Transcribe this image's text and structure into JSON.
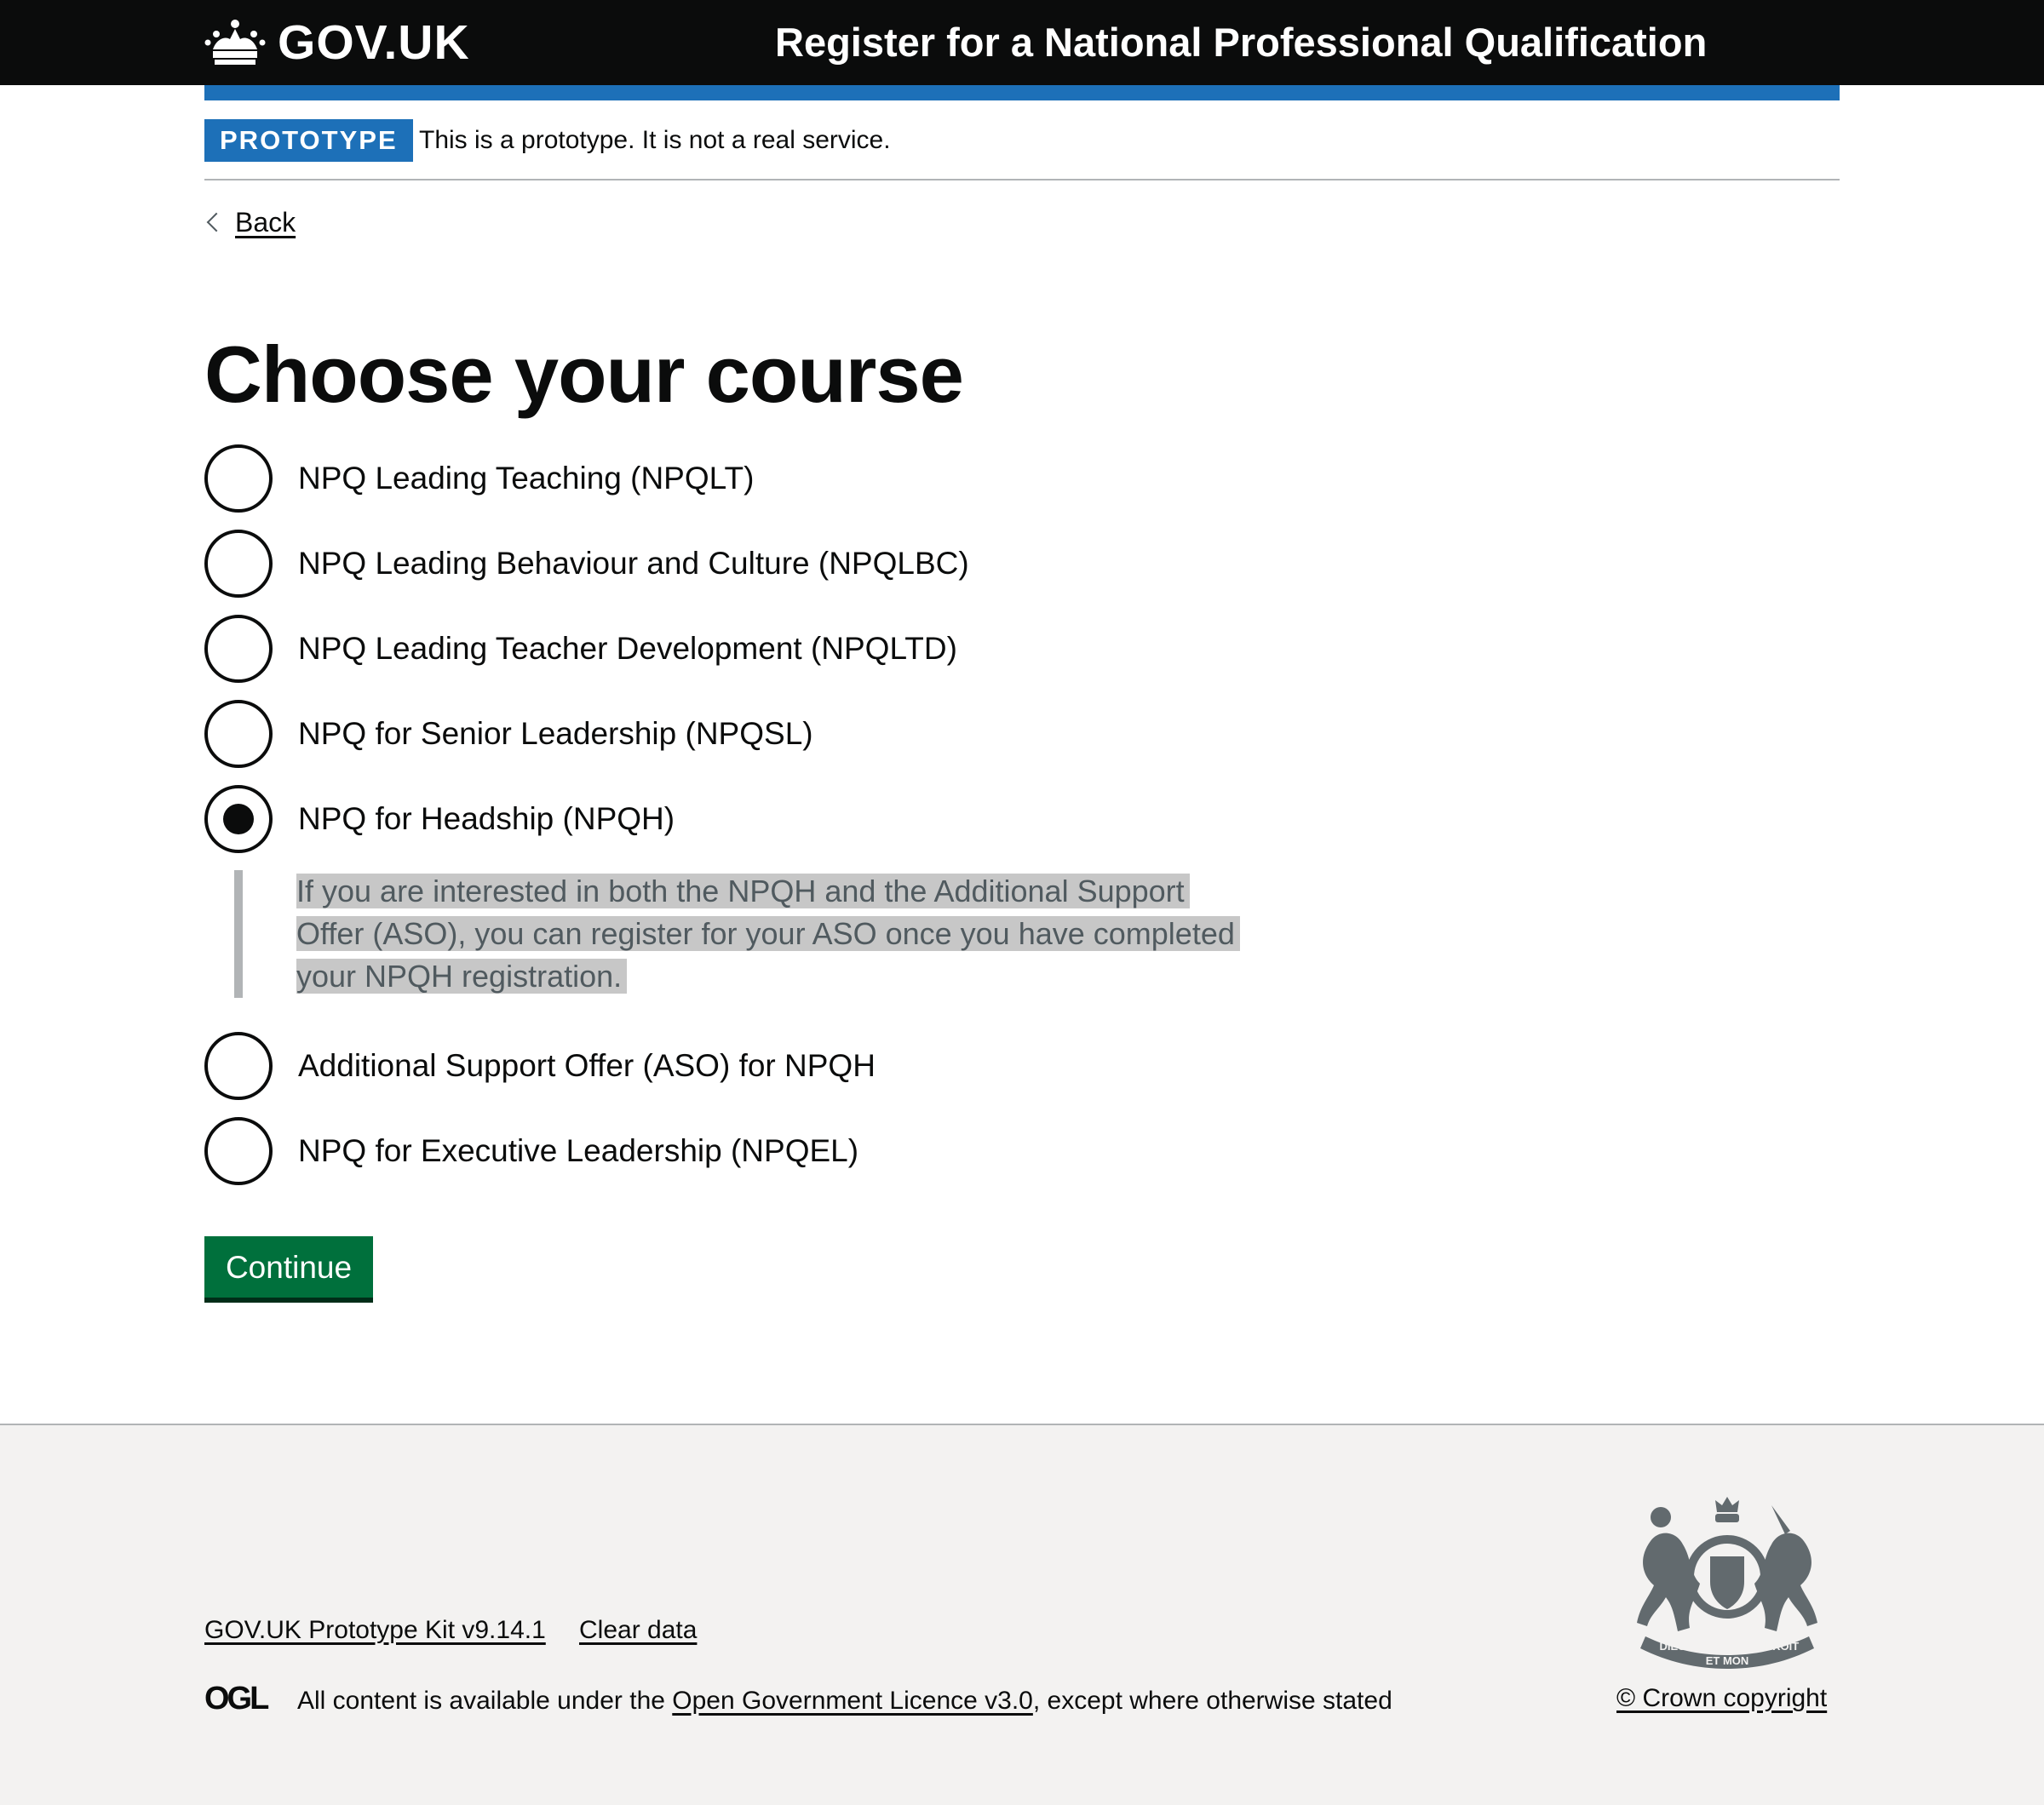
{
  "header": {
    "logo_text": "GOV.UK",
    "service_name": "Register for a National Professional Qualification"
  },
  "phase_banner": {
    "tag": "PROTOTYPE",
    "text": "This is a prototype. It is not a real service."
  },
  "back_link": "Back",
  "page_title": "Choose your course",
  "course_options": [
    {
      "label": "NPQ Leading Teaching (NPQLT)",
      "checked": false
    },
    {
      "label": "NPQ Leading Behaviour and Culture (NPQLBC)",
      "checked": false
    },
    {
      "label": "NPQ Leading Teacher Development (NPQLTD)",
      "checked": false
    },
    {
      "label": "NPQ for Senior Leadership (NPQSL)",
      "checked": false
    },
    {
      "label": "NPQ for Headship (NPQH)",
      "checked": true
    },
    {
      "label": "Additional Support Offer (ASO) for NPQH",
      "checked": false
    },
    {
      "label": "NPQ for Executive Leadership (NPQEL)",
      "checked": false
    }
  ],
  "conditional_hint": "If you are interested in both the NPQH and the Additional Support Offer (ASO), you can register for your ASO once you have completed your NPQH registration.",
  "continue_button": "Continue",
  "footer": {
    "prototype_kit_link": "GOV.UK Prototype Kit v9.14.1",
    "clear_data_link": "Clear data",
    "ogl_logo_text": "OGL",
    "licence_prefix": "All content is available under the ",
    "licence_link": "Open Government Licence v3.0",
    "licence_suffix": ", except where otherwise stated",
    "copyright": "© Crown copyright",
    "crest_text": [
      "DIEU",
      "ET MON",
      "DROIT"
    ]
  },
  "colors": {
    "header_bg": "#0b0c0c",
    "brand_blue": "#1d70b8",
    "button_green": "#00703c",
    "footer_bg": "#f3f2f1",
    "hint_highlight": "#c7c7c7"
  },
  "icons": [
    "crown-icon",
    "chevron-left-icon",
    "ogl-logo-icon",
    "royal-coat-of-arms-icon"
  ]
}
